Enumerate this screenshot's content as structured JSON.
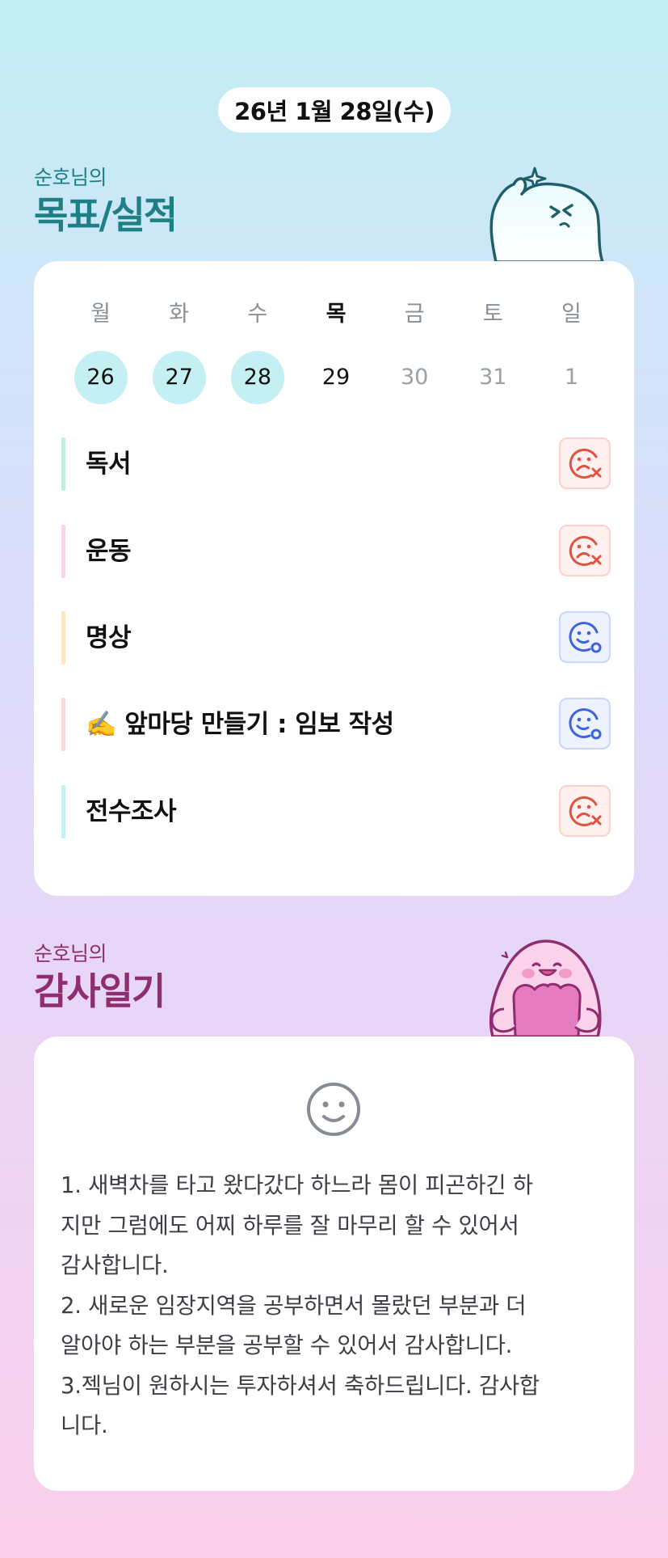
{
  "date_label": "26년 1월 28일(수)",
  "goals_section": {
    "subtitle": "순호님의",
    "title": "목표/실적",
    "week": [
      {
        "day": "월",
        "date": "26",
        "state": "done"
      },
      {
        "day": "화",
        "date": "27",
        "state": "done"
      },
      {
        "day": "수",
        "date": "28",
        "state": "done"
      },
      {
        "day": "목",
        "date": "29",
        "state": "today"
      },
      {
        "day": "금",
        "date": "30",
        "state": "future"
      },
      {
        "day": "토",
        "date": "31",
        "state": "future"
      },
      {
        "day": "일",
        "date": "1",
        "state": "future"
      }
    ],
    "goals": [
      {
        "label": "독서",
        "bar_color": "#bff0df",
        "status": "fail",
        "icon": "sad-x-icon"
      },
      {
        "label": "운동",
        "bar_color": "#fbd3ec",
        "status": "fail",
        "icon": "sad-x-icon"
      },
      {
        "label": "명상",
        "bar_color": "#ffe6c2",
        "status": "ok",
        "icon": "smile-o-icon"
      },
      {
        "label": "✍️ 앞마당 만들기 : 임보 작성",
        "bar_color": "#fdd8d8",
        "status": "ok",
        "icon": "smile-o-icon"
      },
      {
        "label": "전수조사",
        "bar_color": "#c7f0f4",
        "status": "fail",
        "icon": "sad-x-icon"
      }
    ]
  },
  "diary_section": {
    "subtitle": "순호님의",
    "title": "감사일기",
    "mood_icon": "smile-face-icon",
    "text": "1. 새벽차를 타고 왔다갔다 하느라 몸이 피곤하긴 하\n지만 그럼에도 어찌 하루를 잘 마무리 할 수 있어서\n감사합니다.\n2. 새로운 임장지역을 공부하면서 몰랐던 부분과 더\n알아야 하는 부분을 공부할 수 있어서 감사합니다.\n3.젝님이 원하시는 투자하셔서 축하드립니다. 감사합\n니다."
  },
  "colors": {
    "fail": "#e0533f",
    "ok": "#3d63e0",
    "done_day_bg": "#c4f0f4",
    "goals_title": "#1e7f85",
    "diary_title": "#8e2d6f"
  }
}
